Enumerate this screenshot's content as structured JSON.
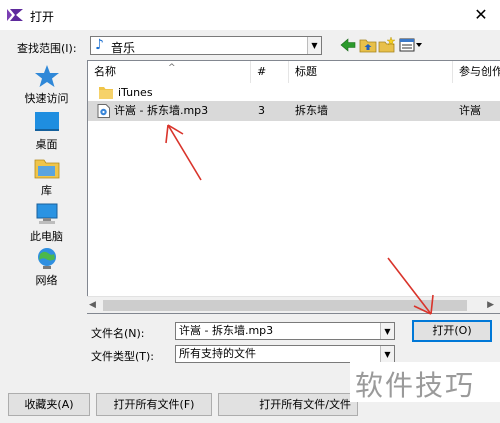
{
  "window": {
    "title": "打开"
  },
  "toolbar": {
    "look_in_label": "查找范围(I):",
    "look_in_value": "音乐"
  },
  "places": [
    {
      "label": "快速访问",
      "icon": "star-icon"
    },
    {
      "label": "桌面",
      "icon": "desktop-icon"
    },
    {
      "label": "库",
      "icon": "library-icon"
    },
    {
      "label": "此电脑",
      "icon": "computer-icon"
    },
    {
      "label": "网络",
      "icon": "network-icon"
    }
  ],
  "columns": [
    "名称",
    "#",
    "标题",
    "参与创作"
  ],
  "rows": [
    {
      "name": "iTunes",
      "num": "",
      "title": "",
      "artist": "",
      "icon": "folder-icon"
    },
    {
      "name": "许嵩 - 拆东墙.mp3",
      "num": "3",
      "title": "拆东墙",
      "artist": "许嵩",
      "icon": "audio-file-icon"
    }
  ],
  "file_name": {
    "label": "文件名(N):",
    "value": "许嵩 - 拆东墙.mp3"
  },
  "file_type": {
    "label": "文件类型(T):",
    "value": "所有支持的文件"
  },
  "buttons": {
    "open": "打开(O)",
    "favorites": "收藏夹(A)",
    "open_all": "打开所有文件(F)",
    "open_all_folders": "打开所有文件/文件"
  },
  "watermark": "软件技巧",
  "colors": {
    "accent": "#0078d7",
    "annotation": "#d9342b",
    "logo": "#7b3fb3"
  }
}
